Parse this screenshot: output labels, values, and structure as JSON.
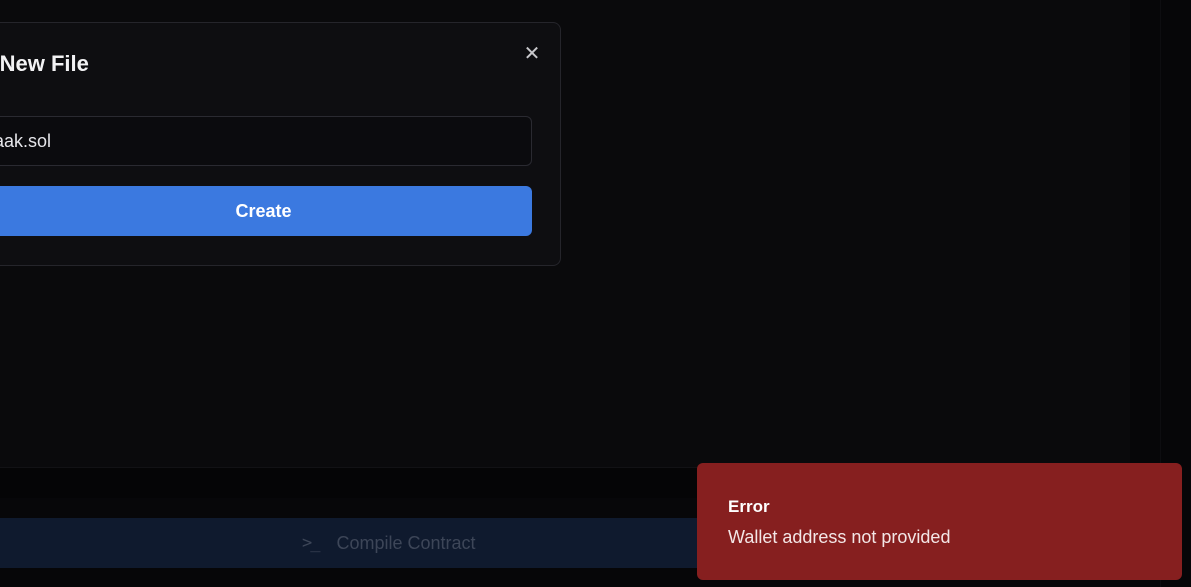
{
  "modal": {
    "title": "Create New File",
    "close_icon": "close-icon",
    "filename_value": "Kraak.sol",
    "create_label": "Create"
  },
  "footer": {
    "compile_icon": "terminal-icon",
    "compile_label": "Compile Contract"
  },
  "toast": {
    "title": "Error",
    "message": "Wallet address not provided"
  },
  "colors": {
    "background": "#0a0a0c",
    "modal_bg": "#0e0e11",
    "primary_button": "#3b79e0",
    "compile_bar": "#0f1a2e",
    "error_toast": "#861f1f"
  }
}
